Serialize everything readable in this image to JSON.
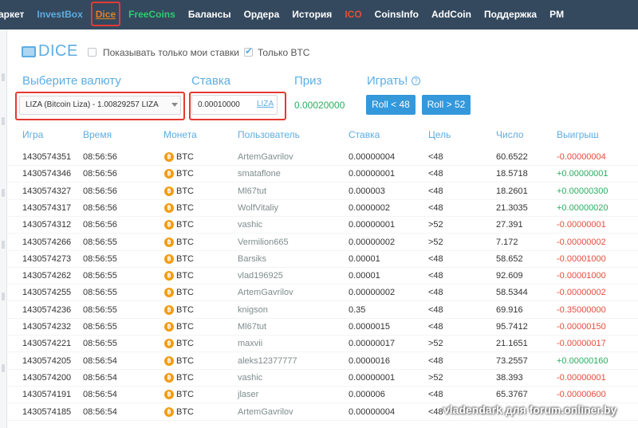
{
  "nav": {
    "items": [
      {
        "label": "аркет",
        "style": "white"
      },
      {
        "label": "InvestBox",
        "style": "blue"
      },
      {
        "label": "Dice",
        "style": "dice"
      },
      {
        "label": "FreeCoins",
        "style": "green"
      },
      {
        "label": "Балансы",
        "style": "white"
      },
      {
        "label": "Ордера",
        "style": "white"
      },
      {
        "label": "История",
        "style": "white"
      },
      {
        "label": "ICO",
        "style": "red"
      },
      {
        "label": "CoinsInfo",
        "style": "white"
      },
      {
        "label": "AddCoin",
        "style": "white"
      },
      {
        "label": "Поддержка",
        "style": "white"
      },
      {
        "label": "PM",
        "style": "white"
      }
    ]
  },
  "header": {
    "title": "DICE",
    "show_my_bets_label": "Показывать только мои ставки",
    "show_my_bets_checked": false,
    "only_btc_label": "Только BTC",
    "only_btc_checked": true
  },
  "form": {
    "currency_label": "Выберите валюту",
    "currency_value": "LIZA (Bitcoin Liza) - 1.00829257 LIZA",
    "stake_label": "Ставка",
    "stake_value": "0.00010000",
    "stake_unit": "LIZA",
    "prize_label": "Приз",
    "prize_value": "0.00020000",
    "play_label": "Играть!",
    "roll_low_label": "Roll < 48",
    "roll_high_label": "Roll > 52"
  },
  "table": {
    "headers": [
      "Игра",
      "Время",
      "Монета",
      "Пользователь",
      "Ставка",
      "Цель",
      "Число",
      "Выигрыш"
    ],
    "rows": [
      {
        "game": "1430574351",
        "time": "08:56:56",
        "coin": "BTC",
        "user": "ArtemGavrilov",
        "stake": "0.00000004",
        "target": "<48",
        "number": "60.6522",
        "win": "-0.00000004"
      },
      {
        "game": "1430574346",
        "time": "08:56:56",
        "coin": "BTC",
        "user": "smataflone",
        "stake": "0.00000001",
        "target": "<48",
        "number": "18.5718",
        "win": "+0.00000001"
      },
      {
        "game": "1430574327",
        "time": "08:56:56",
        "coin": "BTC",
        "user": "Ml67tut",
        "stake": "0.000003",
        "target": "<48",
        "number": "18.2601",
        "win": "+0.00000300"
      },
      {
        "game": "1430574317",
        "time": "08:56:56",
        "coin": "BTC",
        "user": "WolfVitaliy",
        "stake": "0.0000002",
        "target": "<48",
        "number": "21.3035",
        "win": "+0.00000020"
      },
      {
        "game": "1430574312",
        "time": "08:56:56",
        "coin": "BTC",
        "user": "vashic",
        "stake": "0.00000001",
        "target": ">52",
        "number": "27.391",
        "win": "-0.00000001"
      },
      {
        "game": "1430574266",
        "time": "08:56:55",
        "coin": "BTC",
        "user": "Vermilion665",
        "stake": "0.00000002",
        "target": ">52",
        "number": "7.172",
        "win": "-0.00000002"
      },
      {
        "game": "1430574273",
        "time": "08:56:55",
        "coin": "BTC",
        "user": "Barsiks",
        "stake": "0.00001",
        "target": "<48",
        "number": "58.652",
        "win": "-0.00001000"
      },
      {
        "game": "1430574262",
        "time": "08:56:55",
        "coin": "BTC",
        "user": "vlad196925",
        "stake": "0.00001",
        "target": "<48",
        "number": "92.609",
        "win": "-0.00001000"
      },
      {
        "game": "1430574255",
        "time": "08:56:55",
        "coin": "BTC",
        "user": "ArtemGavrilov",
        "stake": "0.00000002",
        "target": "<48",
        "number": "58.5344",
        "win": "-0.00000002"
      },
      {
        "game": "1430574236",
        "time": "08:56:55",
        "coin": "BTC",
        "user": "knigson",
        "stake": "0.35",
        "target": "<48",
        "number": "69.916",
        "win": "-0.35000000"
      },
      {
        "game": "1430574232",
        "time": "08:56:55",
        "coin": "BTC",
        "user": "Ml67tut",
        "stake": "0.0000015",
        "target": "<48",
        "number": "95.7412",
        "win": "-0.00000150"
      },
      {
        "game": "1430574221",
        "time": "08:56:55",
        "coin": "BTC",
        "user": "maxvii",
        "stake": "0.00000017",
        "target": ">52",
        "number": "21.1651",
        "win": "-0.00000017"
      },
      {
        "game": "1430574205",
        "time": "08:56:54",
        "coin": "BTC",
        "user": "aleks12377777",
        "stake": "0.0000016",
        "target": "<48",
        "number": "73.2557",
        "win": "+0.00000160"
      },
      {
        "game": "1430574200",
        "time": "08:56:54",
        "coin": "BTC",
        "user": "vashic",
        "stake": "0.00000001",
        "target": ">52",
        "number": "38.393",
        "win": "-0.00000001"
      },
      {
        "game": "1430574191",
        "time": "08:56:54",
        "coin": "BTC",
        "user": "jlaser",
        "stake": "0.000006",
        "target": "<48",
        "number": "65.3767",
        "win": "-0.00000600"
      },
      {
        "game": "1430574185",
        "time": "08:56:54",
        "coin": "BTC",
        "user": "ArtemGavrilov",
        "stake": "0.00000004",
        "target": "<48",
        "number": "",
        "win": ""
      }
    ]
  },
  "watermark": "vladendark для forum.onliner.by",
  "colors": {
    "nav_bg": "#34495e",
    "accent": "#5dade2",
    "button": "#3498db",
    "positive": "#27ae60",
    "negative": "#e74c3c",
    "highlight": "#e53935",
    "coin": "#f39c12"
  }
}
